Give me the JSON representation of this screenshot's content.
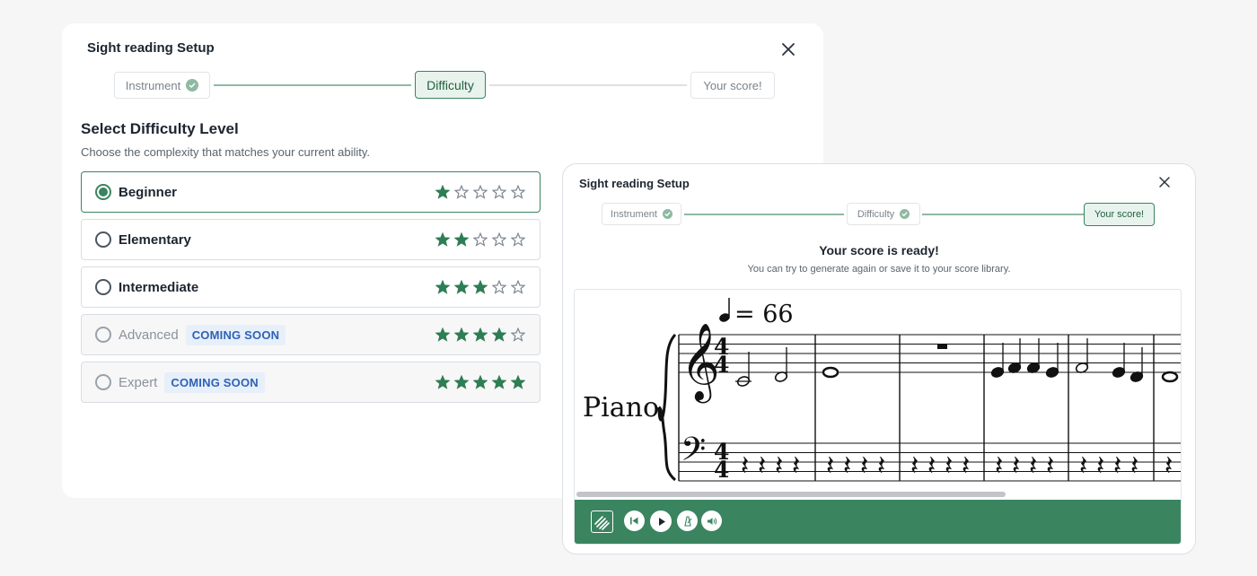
{
  "setup_back": {
    "title": "Sight reading Setup",
    "steps": [
      {
        "label": "Instrument",
        "completed": true
      },
      {
        "label": "Difficulty",
        "active": true
      },
      {
        "label": "Your score!"
      }
    ],
    "heading": "Select Difficulty Level",
    "subheading": "Choose the complexity that matches your current ability.",
    "options": [
      {
        "label": "Beginner",
        "stars": 1,
        "selected": true
      },
      {
        "label": "Elementary",
        "stars": 2
      },
      {
        "label": "Intermediate",
        "stars": 3
      },
      {
        "label": "Advanced",
        "stars": 4,
        "badge": "COMING SOON",
        "disabled": true
      },
      {
        "label": "Expert",
        "stars": 5,
        "badge": "COMING SOON",
        "disabled": true
      }
    ]
  },
  "setup_front": {
    "title": "Sight reading Setup",
    "steps": [
      {
        "label": "Instrument",
        "completed": true
      },
      {
        "label": "Difficulty",
        "completed": true
      },
      {
        "label": "Your score!",
        "active": true
      }
    ],
    "ready_title": "Your score is ready!",
    "ready_subtitle": "You can try to generate again or save it to your score library.",
    "score": {
      "tempo": "= 66",
      "instrument": "Piano",
      "time_signature": "4/4"
    },
    "toolbar": [
      "logo-icon",
      "rewind-icon",
      "play-icon",
      "metronome-icon",
      "volume-icon"
    ]
  },
  "colors": {
    "accent": "#3a8460",
    "accent_light": "#e7f3ec",
    "badge_bg": "#e7effa",
    "badge_text": "#2f62b5",
    "star": "#2e7d55"
  }
}
